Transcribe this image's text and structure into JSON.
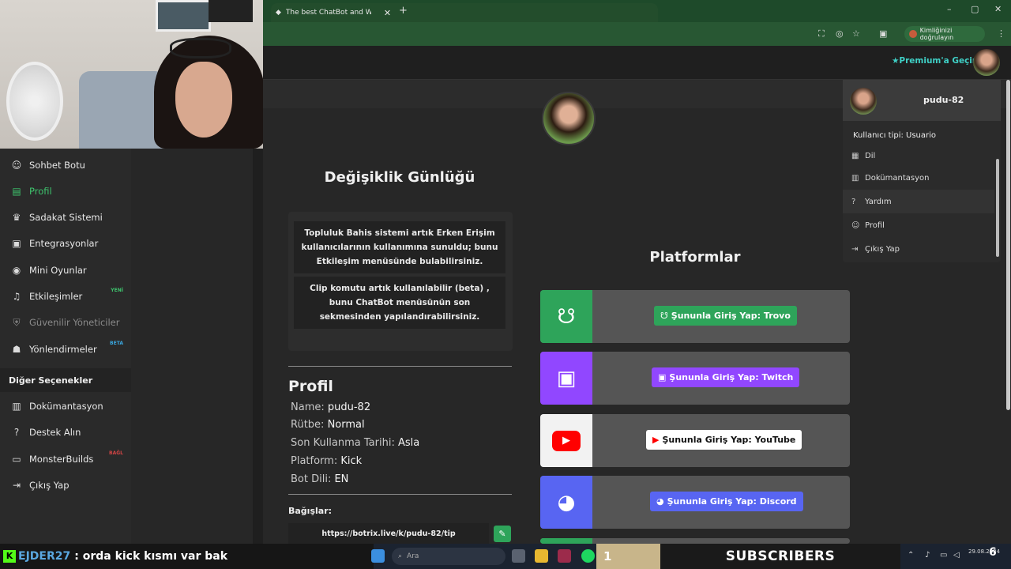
{
  "browser": {
    "tab_title": "The best ChatBot and Widgets",
    "profile_pill": "Kimliğinizi doğrulayın"
  },
  "topnav": {
    "premium_label": "Premium'a Geçin"
  },
  "sidebar": {
    "items": [
      {
        "label": "Sohbet Botu",
        "icon": "robot-icon"
      },
      {
        "label": "Profil",
        "icon": "id-card-icon"
      },
      {
        "label": "Sadakat Sistemi",
        "icon": "trophy-icon"
      },
      {
        "label": "Entegrasyonlar",
        "icon": "plug-icon"
      },
      {
        "label": "Mini Oyunlar",
        "icon": "gamepad-icon"
      },
      {
        "label": "Etkileşimler",
        "icon": "music-icon",
        "badge": "YENİ"
      },
      {
        "label": "Güvenilir Yöneticiler",
        "icon": "shield-icon"
      },
      {
        "label": "Yönlendirmeler",
        "icon": "users-icon",
        "badge": "BETA"
      }
    ],
    "section_title": "Diğer Seçenekler",
    "other_items": [
      {
        "label": "Dokümantasyon",
        "icon": "book-icon"
      },
      {
        "label": "Destek Alın",
        "icon": "question-icon"
      },
      {
        "label": "MonsterBuilds",
        "icon": "monitor-icon",
        "badge": "BAĞL"
      },
      {
        "label": "Çıkış Yap",
        "icon": "logout-icon"
      }
    ]
  },
  "changelog": {
    "title": "Değişiklik Günlüğü",
    "entries": [
      "Topluluk Bahis sistemi artık Erken Erişim kullanıcılarının kullanımına sunuldu; bunu Etkileşim menüsünde bulabilirsiniz.",
      "Clip komutu artık kullanılabilir (beta) , bunu ChatBot menüsünün son sekmesinden yapılandırabilirsiniz."
    ]
  },
  "profile": {
    "title": "Profil",
    "rows": [
      {
        "label": "Name:",
        "value": "pudu-82"
      },
      {
        "label": "Rütbe:",
        "value": "Normal"
      },
      {
        "label": "Son Kullanma Tarihi:",
        "value": "Asla"
      },
      {
        "label": "Platform:",
        "value": "Kick"
      },
      {
        "label": "Bot Dili:",
        "value": "EN"
      }
    ],
    "links_label": "Bağışlar:",
    "tip_url": "https://botrix.live/k/pudu-82/tip"
  },
  "platforms": {
    "title": "Platformlar",
    "items": [
      {
        "label": "Şununla Giriş Yap: Trovo",
        "icon": "trovo-icon",
        "color": "#2ea45a"
      },
      {
        "label": "Şununla Giriş Yap: Twitch",
        "icon": "twitch-icon",
        "color": "#9147ff"
      },
      {
        "label": "Şununla Giriş Yap: YouTube",
        "icon": "youtube-icon",
        "color": "#ff0000"
      },
      {
        "label": "Şununla Giriş Yap: Discord",
        "icon": "discord-icon",
        "color": "#5865f2"
      }
    ]
  },
  "dropdown": {
    "username": "pudu-82",
    "user_type": "Kullanıcı tipi: Usuario",
    "items": [
      {
        "label": "Dil",
        "icon": "language-icon"
      },
      {
        "label": "Dokümantasyon",
        "icon": "book-icon"
      },
      {
        "label": "Yardım",
        "icon": "question-icon"
      },
      {
        "label": "Profil",
        "icon": "user-icon"
      },
      {
        "label": "Çıkış Yap",
        "icon": "logout-icon"
      }
    ]
  },
  "taskbar": {
    "chat_user": "EJDER27",
    "chat_message": ": orda kick kısmı var bak",
    "search_placeholder": "Ara",
    "subscriber_count": "1",
    "subscriber_label": "SUBSCRIBERS",
    "clock_date": "29.08.2024",
    "notification_count": "6"
  },
  "colors": {
    "accent_green": "#3ec46d",
    "premium": "#3fd0c6"
  }
}
